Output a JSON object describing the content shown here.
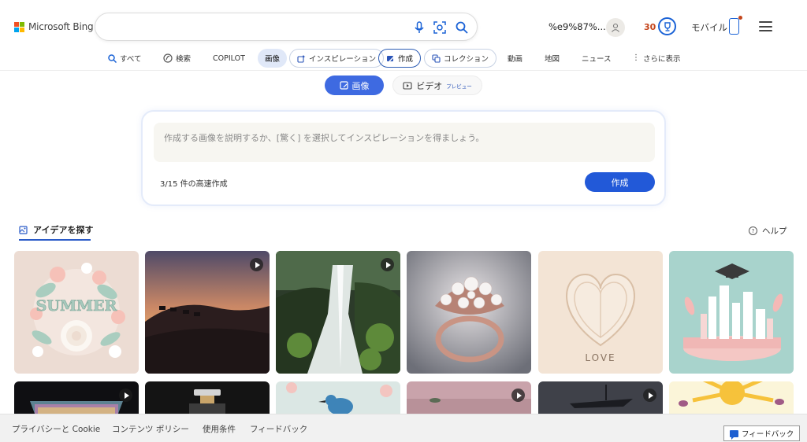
{
  "header": {
    "logo_text": "Microsoft Bing",
    "search_value": "",
    "user_text": "%e9%87%...",
    "points": "30",
    "mobile_label": "モバイル"
  },
  "nav": {
    "items": [
      {
        "label": "すべて",
        "icon": "search-icon"
      },
      {
        "label": "検索",
        "icon": "copilot-search-icon"
      },
      {
        "label": "COPILOT"
      },
      {
        "label": "画像"
      },
      {
        "label": "インスピレーション",
        "icon": "inspiration-icon"
      },
      {
        "label": "作成",
        "icon": "create-icon"
      },
      {
        "label": "コレクション",
        "icon": "collection-icon"
      },
      {
        "label": "動画"
      },
      {
        "label": "地図"
      },
      {
        "label": "ニュース"
      },
      {
        "label": "さらに表示",
        "icon": "more-dots-icon"
      }
    ]
  },
  "mode": {
    "image_label": "画像",
    "video_label": "ビデオ",
    "preview_label": "プレビュー"
  },
  "prompt": {
    "placeholder": "作成する画像を説明するか、[驚く] を選択してインスピレーションを得ましょう。",
    "boost_text": "3/15 件の高速作成",
    "create_label": "作成"
  },
  "explore": {
    "tab_label": "アイデアを探す",
    "help_label": "ヘルプ",
    "gallery": [
      {
        "name": "summer-paper-flowers",
        "video": false
      },
      {
        "name": "desert-camels-sunset",
        "video": true
      },
      {
        "name": "forest-waterfall",
        "video": true
      },
      {
        "name": "pearl-ring",
        "video": false
      },
      {
        "name": "paper-heart-love",
        "video": false,
        "caption": "LOVE"
      },
      {
        "name": "graduation-city",
        "video": false
      },
      {
        "name": "rainbow-glass",
        "video": true
      },
      {
        "name": "perfume-bottle",
        "video": false
      },
      {
        "name": "kingfisher-bird",
        "video": false
      },
      {
        "name": "pink-landscape",
        "video": true
      },
      {
        "name": "dark-ship",
        "video": true
      },
      {
        "name": "sun-butterflies",
        "video": false
      }
    ]
  },
  "footer": {
    "links": [
      "プライバシーと Cookie",
      "コンテンツ ポリシー",
      "使用条件",
      "フィードバック"
    ],
    "feedback_label": "フィードバック"
  },
  "colors": {
    "accent": "#2259d8",
    "toggle_active": "#3e6ae1",
    "points": "#c4451b"
  }
}
